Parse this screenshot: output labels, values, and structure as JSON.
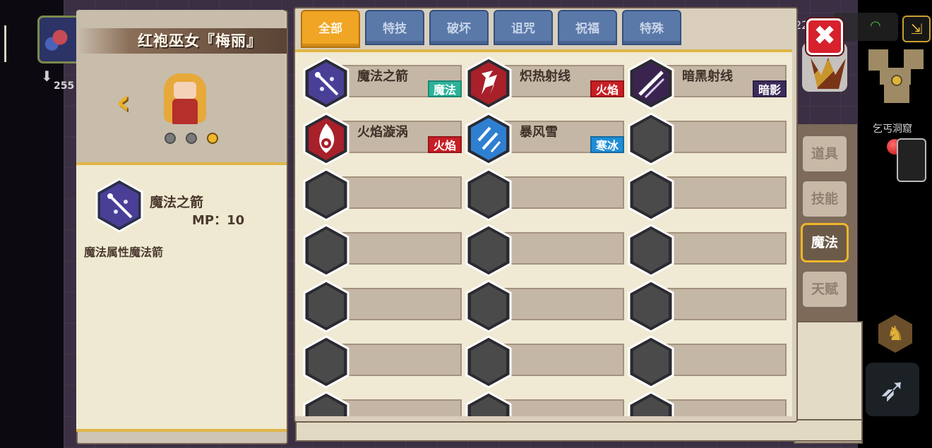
{
  "hud": {
    "coin_count": "255",
    "top_number": "22",
    "location_name": "乞丐洞窟"
  },
  "character": {
    "name": "红袍巫女『梅丽』",
    "page_dots": [
      false,
      false,
      true
    ]
  },
  "selected_skill": {
    "name": "魔法之箭",
    "mp": "MP：10",
    "description": "魔法属性魔法箭"
  },
  "tabs": [
    {
      "label": "全部",
      "active": true
    },
    {
      "label": "特技",
      "active": false
    },
    {
      "label": "破坏",
      "active": false
    },
    {
      "label": "诅咒",
      "active": false
    },
    {
      "label": "祝福",
      "active": false
    },
    {
      "label": "特殊",
      "active": false
    }
  ],
  "skills": [
    {
      "name": "魔法之箭",
      "tag": "魔法",
      "tag_color": "#2bb39a",
      "icon": "magic-arrow-icon",
      "hex_color": "#4a3f97"
    },
    {
      "name": "炽热射线",
      "tag": "火焰",
      "tag_color": "#c81e25",
      "icon": "fire-ray-icon",
      "hex_color": "#a8202a"
    },
    {
      "name": "暗黑射线",
      "tag": "暗影",
      "tag_color": "#3d2b5c",
      "icon": "dark-ray-icon",
      "hex_color": "#3a244f"
    },
    {
      "name": "火焰漩涡",
      "tag": "火焰",
      "tag_color": "#c81e25",
      "icon": "fire-vortex-icon",
      "hex_color": "#a8202a"
    },
    {
      "name": "暴风雪",
      "tag": "寒冰",
      "tag_color": "#1f8ed6",
      "icon": "blizzard-icon",
      "hex_color": "#2f7fd1"
    }
  ],
  "categories": [
    {
      "label": "道具",
      "active": false
    },
    {
      "label": "技能",
      "active": false
    },
    {
      "label": "魔法",
      "active": true
    },
    {
      "label": "天赋",
      "active": false
    }
  ]
}
